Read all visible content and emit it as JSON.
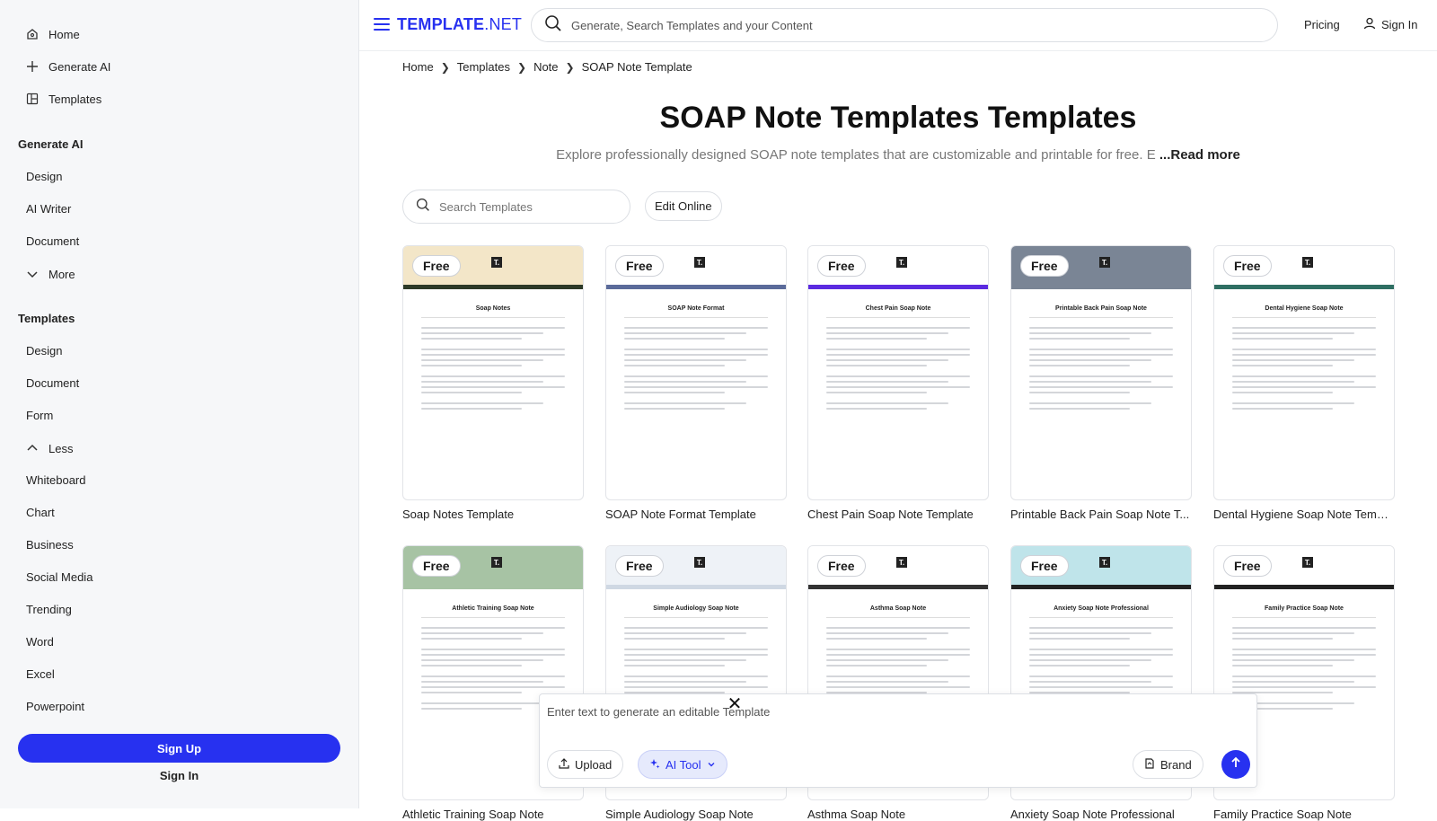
{
  "sidebar": {
    "top_items": [
      {
        "label": "Home",
        "icon": "home-icon"
      },
      {
        "label": "Generate AI",
        "icon": "plus-icon"
      },
      {
        "label": "Templates",
        "icon": "templates-icon"
      }
    ],
    "generate_heading": "Generate AI",
    "generate_items": [
      "Design",
      "AI Writer",
      "Document"
    ],
    "more_label": "More",
    "templates_heading": "Templates",
    "template_items": [
      "Design",
      "Document",
      "Form"
    ],
    "less_label": "Less",
    "extra_items": [
      "Whiteboard",
      "Chart",
      "Business",
      "Social Media",
      "Trending",
      "Word",
      "Excel",
      "Powerpoint"
    ],
    "signup_label": "Sign Up",
    "signin_label": "Sign In"
  },
  "header": {
    "logo_main": "TEMPLATE",
    "logo_suffix": ".NET",
    "search_placeholder": "Generate, Search Templates and your Content",
    "pricing_label": "Pricing",
    "signin_label": "Sign In"
  },
  "breadcrumb": [
    "Home",
    "Templates",
    "Note",
    "SOAP Note Template"
  ],
  "page": {
    "title": "SOAP Note Templates Templates",
    "subtitle": "Explore professionally designed SOAP note templates that are customizable and printable for free. E",
    "read_more": "...Read more",
    "search_placeholder": "Search Templates",
    "edit_online_label": "Edit Online"
  },
  "free_label": "Free",
  "templates": [
    {
      "label": "Soap Notes Template",
      "doc_title": "Soap Notes",
      "band": "#f3e6c8",
      "accent": "#2d3a28"
    },
    {
      "label": "SOAP Note Format Template",
      "doc_title": "SOAP Note Format",
      "band": "#ffffff",
      "accent": "#5b6b9a"
    },
    {
      "label": "Chest Pain Soap Note Template",
      "doc_title": "Chest Pain Soap Note",
      "band": "#ffffff",
      "accent": "#5b2be0"
    },
    {
      "label": "Printable Back Pain Soap Note T...",
      "doc_title": "Printable Back Pain Soap Note",
      "band": "#7a8595",
      "accent": "#7a8595"
    },
    {
      "label": "Dental Hygiene Soap Note Templ...",
      "doc_title": "Dental Hygiene Soap Note",
      "band": "#ffffff",
      "accent": "#2f6f63"
    },
    {
      "label": "Athletic Training Soap Note",
      "doc_title": "Athletic Training Soap Note",
      "band": "#a7c3a4",
      "accent": "#a7c3a4"
    },
    {
      "label": "Simple Audiology Soap Note",
      "doc_title": "Simple Audiology Soap Note",
      "band": "#eef2f7",
      "accent": "#cfd8e3"
    },
    {
      "label": "Asthma Soap Note",
      "doc_title": "Asthma Soap Note",
      "band": "#ffffff",
      "accent": "#333333"
    },
    {
      "label": "Anxiety Soap Note Professional",
      "doc_title": "Anxiety Soap Note Professional",
      "band": "#bfe4ea",
      "accent": "#222222"
    },
    {
      "label": "Family Practice Soap Note",
      "doc_title": "Family Practice Soap Note",
      "band": "#ffffff",
      "accent": "#222222"
    }
  ],
  "ai_panel": {
    "placeholder": "Enter text to generate an editable Template",
    "upload_label": "Upload",
    "ai_tool_label": "AI Tool",
    "brand_label": "Brand"
  },
  "colors": {
    "brand": "#2731f0"
  }
}
